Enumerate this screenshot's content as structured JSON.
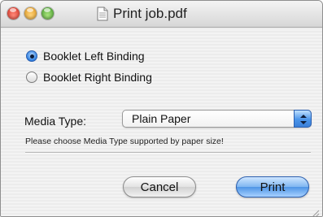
{
  "window": {
    "title": "Print job.pdf"
  },
  "binding": {
    "options": [
      {
        "label": "Booklet Left Binding",
        "selected": true
      },
      {
        "label": "Booklet Right Binding",
        "selected": false
      }
    ]
  },
  "media": {
    "label": "Media Type:",
    "selected": "Plain Paper",
    "hint": "Please choose Media Type supported by paper size!"
  },
  "buttons": {
    "cancel": "Cancel",
    "print": "Print"
  },
  "colors": {
    "accent": "#4b95ea",
    "close": "#d52b1e",
    "minimize": "#e0961a",
    "zoom": "#3f9b2a"
  },
  "icons": [
    "close-icon",
    "minimize-icon",
    "zoom-icon",
    "document-icon",
    "stepper-arrows-icon",
    "resize-grip-icon"
  ]
}
